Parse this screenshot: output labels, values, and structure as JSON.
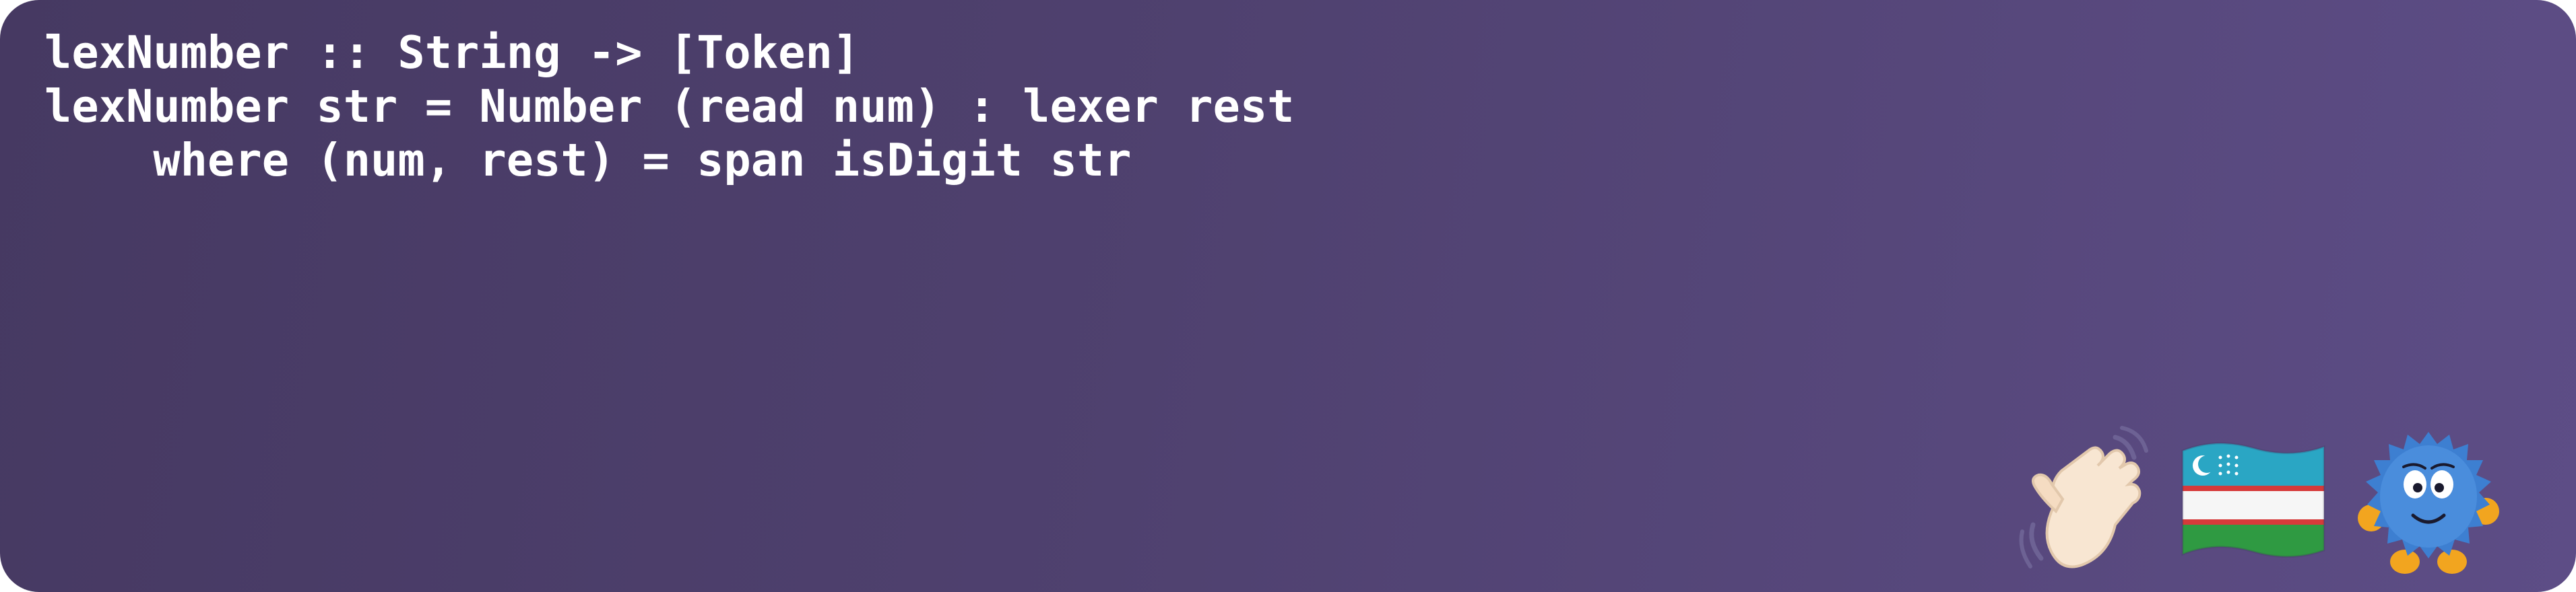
{
  "code": {
    "lines": [
      "lexNumber :: String -> [Token]",
      "lexNumber str = Number (read num) : lexer rest",
      "    where (num, rest) = span isDigit str"
    ]
  },
  "emojis": [
    {
      "name": "waving-hand-icon"
    },
    {
      "name": "uzbekistan-flag-icon"
    },
    {
      "name": "fuzzy-monster-icon"
    }
  ],
  "colors": {
    "background_start": "#463962",
    "background_end": "#5d4d86",
    "text": "#ffffff"
  }
}
